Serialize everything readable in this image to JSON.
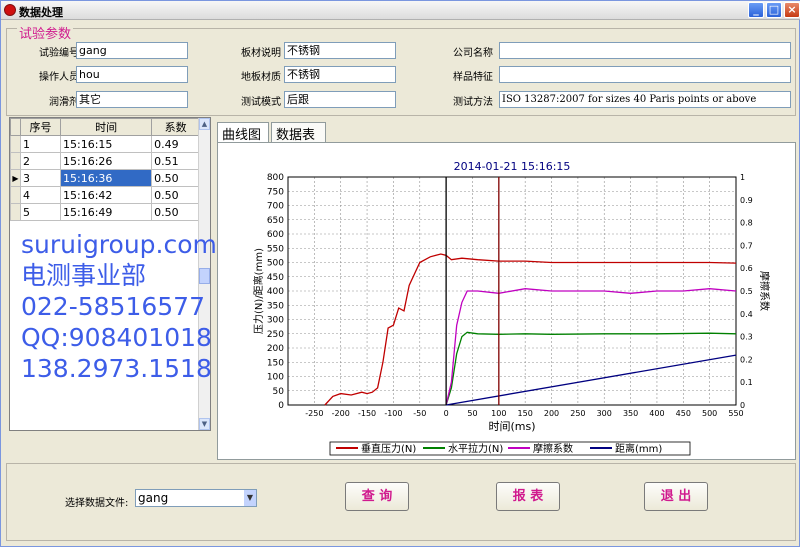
{
  "window": {
    "title": "数据处理"
  },
  "params": {
    "legend": "试验参数",
    "fields": [
      {
        "label": "试验编号",
        "value": "gang"
      },
      {
        "label": "操作人员",
        "value": "hou"
      },
      {
        "label": "润滑剂",
        "value": "其它"
      },
      {
        "label": "板材说明",
        "value": "不锈钢"
      },
      {
        "label": "地板材质",
        "value": "不锈钢"
      },
      {
        "label": "测试模式",
        "value": "后跟"
      },
      {
        "label": "公司名称",
        "value": ""
      },
      {
        "label": "样品特征",
        "value": ""
      },
      {
        "label": "测试方法",
        "value": "ISO 13287:2007 for sizes 40 Paris points or above"
      }
    ]
  },
  "grid": {
    "headers": [
      "序号",
      "时间",
      "系数"
    ],
    "rows": [
      {
        "num": "1",
        "time": "15:16:15",
        "coef": "0.49"
      },
      {
        "num": "2",
        "time": "15:16:26",
        "coef": "0.51"
      },
      {
        "num": "3",
        "time": "15:16:36",
        "coef": "0.50"
      },
      {
        "num": "4",
        "time": "15:16:42",
        "coef": "0.50"
      },
      {
        "num": "5",
        "time": "15:16:49",
        "coef": "0.50"
      }
    ],
    "selected_index": 2
  },
  "tabs": [
    "曲线图",
    "数据表"
  ],
  "watermark": [
    "suruigroup.com",
    "电测事业部",
    "022-58516577",
    "QQ:908401018",
    "138.2973.1518"
  ],
  "bottom": {
    "file_label": "选择数据文件:",
    "file_value": "gang",
    "query_btn": "查 询",
    "report_btn": "报 表",
    "exit_btn": "退 出"
  },
  "chart_data": {
    "type": "line",
    "title": "2014-01-21 15:16:15",
    "xlabel": "时间(ms)",
    "ylabel_left": "压力(N)/距离(mm)",
    "ylabel_right": "摩擦系数",
    "xlim": [
      -300,
      550
    ],
    "ylim_left": [
      0,
      800
    ],
    "ylim_right": [
      0,
      1
    ],
    "x_ticks": [
      -250,
      -200,
      -150,
      -100,
      -50,
      0,
      50,
      100,
      150,
      200,
      250,
      300,
      350,
      400,
      450,
      500,
      550
    ],
    "y_ticks_left": [
      0,
      50,
      100,
      150,
      200,
      250,
      300,
      350,
      400,
      450,
      500,
      550,
      600,
      650,
      700,
      750,
      800
    ],
    "y_ticks_right": [
      0,
      0.1,
      0.2,
      0.3,
      0.4,
      0.5,
      0.6,
      0.7,
      0.8,
      0.9,
      1
    ],
    "grid": true,
    "markers": [
      {
        "x": 0,
        "color": "#000000"
      },
      {
        "x": 100,
        "color": "#800000"
      }
    ],
    "series": [
      {
        "name": "垂直压力(N)",
        "color": "#c00000",
        "axis": "left",
        "points": [
          [
            -230,
            0
          ],
          [
            -215,
            30
          ],
          [
            -200,
            40
          ],
          [
            -180,
            35
          ],
          [
            -160,
            45
          ],
          [
            -150,
            40
          ],
          [
            -140,
            45
          ],
          [
            -130,
            60
          ],
          [
            -120,
            150
          ],
          [
            -110,
            270
          ],
          [
            -100,
            280
          ],
          [
            -90,
            340
          ],
          [
            -80,
            330
          ],
          [
            -70,
            420
          ],
          [
            -60,
            460
          ],
          [
            -50,
            500
          ],
          [
            -40,
            510
          ],
          [
            -30,
            520
          ],
          [
            -20,
            525
          ],
          [
            -10,
            530
          ],
          [
            0,
            525
          ],
          [
            10,
            510
          ],
          [
            30,
            515
          ],
          [
            60,
            510
          ],
          [
            100,
            505
          ],
          [
            150,
            505
          ],
          [
            200,
            500
          ],
          [
            300,
            500
          ],
          [
            400,
            500
          ],
          [
            500,
            500
          ],
          [
            550,
            498
          ]
        ]
      },
      {
        "name": "水平拉力(N)",
        "color": "#008000",
        "axis": "left",
        "points": [
          [
            0,
            0
          ],
          [
            10,
            60
          ],
          [
            20,
            180
          ],
          [
            30,
            240
          ],
          [
            40,
            255
          ],
          [
            60,
            250
          ],
          [
            100,
            248
          ],
          [
            150,
            250
          ],
          [
            200,
            248
          ],
          [
            300,
            250
          ],
          [
            400,
            250
          ],
          [
            500,
            252
          ],
          [
            550,
            250
          ]
        ]
      },
      {
        "name": "摩擦系数",
        "color": "#c000c0",
        "axis": "right",
        "points": [
          [
            0,
            0
          ],
          [
            10,
            0.1
          ],
          [
            20,
            0.35
          ],
          [
            30,
            0.45
          ],
          [
            40,
            0.5
          ],
          [
            60,
            0.5
          ],
          [
            100,
            0.49
          ],
          [
            150,
            0.51
          ],
          [
            200,
            0.5
          ],
          [
            250,
            0.5
          ],
          [
            300,
            0.5
          ],
          [
            350,
            0.49
          ],
          [
            400,
            0.5
          ],
          [
            450,
            0.5
          ],
          [
            500,
            0.51
          ],
          [
            550,
            0.5
          ]
        ]
      },
      {
        "name": "距离(mm)",
        "color": "#000080",
        "axis": "left",
        "points": [
          [
            0,
            0
          ],
          [
            550,
            175
          ]
        ]
      }
    ]
  }
}
